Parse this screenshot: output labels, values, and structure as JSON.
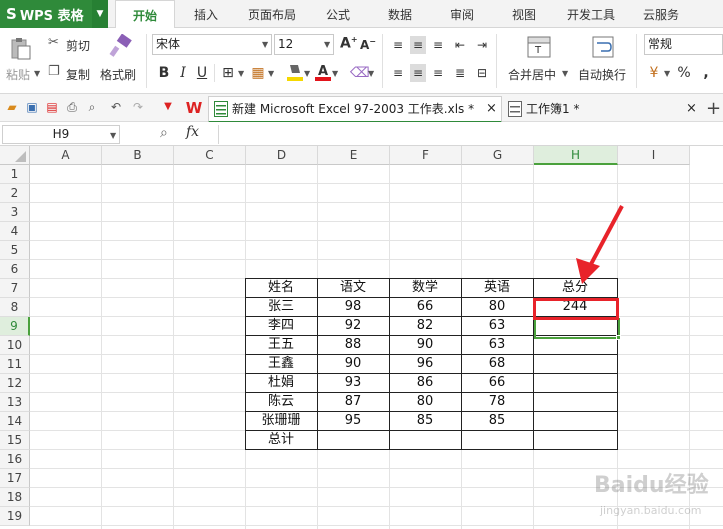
{
  "menubar": {
    "logo": "WPS 表格",
    "tabs": [
      "开始",
      "插入",
      "页面布局",
      "公式",
      "数据",
      "审阅",
      "视图",
      "开发工具",
      "云服务"
    ]
  },
  "ribbon": {
    "paste": "粘贴",
    "cut": "剪切",
    "copy": "复制",
    "format_painter": "格式刷",
    "font_name": "宋体",
    "font_size": "12",
    "merge_center": "合并居中",
    "wrap_text": "自动换行",
    "number_format": "常规"
  },
  "doc_tabs": [
    {
      "label": "新建 Microsoft Excel 97-2003 工作表.xls *",
      "close": "×"
    },
    {
      "label": "工作簿1 *",
      "close": "×"
    }
  ],
  "formula": {
    "name_box": "H9",
    "fx": "fx",
    "value": ""
  },
  "columns": [
    "A",
    "B",
    "C",
    "D",
    "E",
    "F",
    "G",
    "H",
    "I"
  ],
  "rows": [
    "1",
    "2",
    "3",
    "4",
    "5",
    "6",
    "7",
    "8",
    "9",
    "10",
    "11",
    "12",
    "13",
    "14",
    "15",
    "16",
    "17",
    "18",
    "19"
  ],
  "table": {
    "headers": [
      "姓名",
      "语文",
      "数学",
      "英语",
      "总分"
    ],
    "rows": [
      [
        "张三",
        "98",
        "66",
        "80",
        "244"
      ],
      [
        "李四",
        "92",
        "82",
        "63",
        ""
      ],
      [
        "王五",
        "88",
        "90",
        "63",
        ""
      ],
      [
        "王鑫",
        "90",
        "96",
        "68",
        ""
      ],
      [
        "杜娟",
        "93",
        "86",
        "66",
        ""
      ],
      [
        "陈云",
        "87",
        "80",
        "78",
        ""
      ],
      [
        "张珊珊",
        "95",
        "85",
        "85",
        ""
      ],
      [
        "总计",
        "",
        "",
        "",
        ""
      ]
    ]
  },
  "colors": {
    "wps_green": "#2f8a3a",
    "highlight_red": "#e8232a",
    "selection_green": "#4aa13c"
  },
  "watermark": "Baidu经验 jingyan.baidu.com"
}
